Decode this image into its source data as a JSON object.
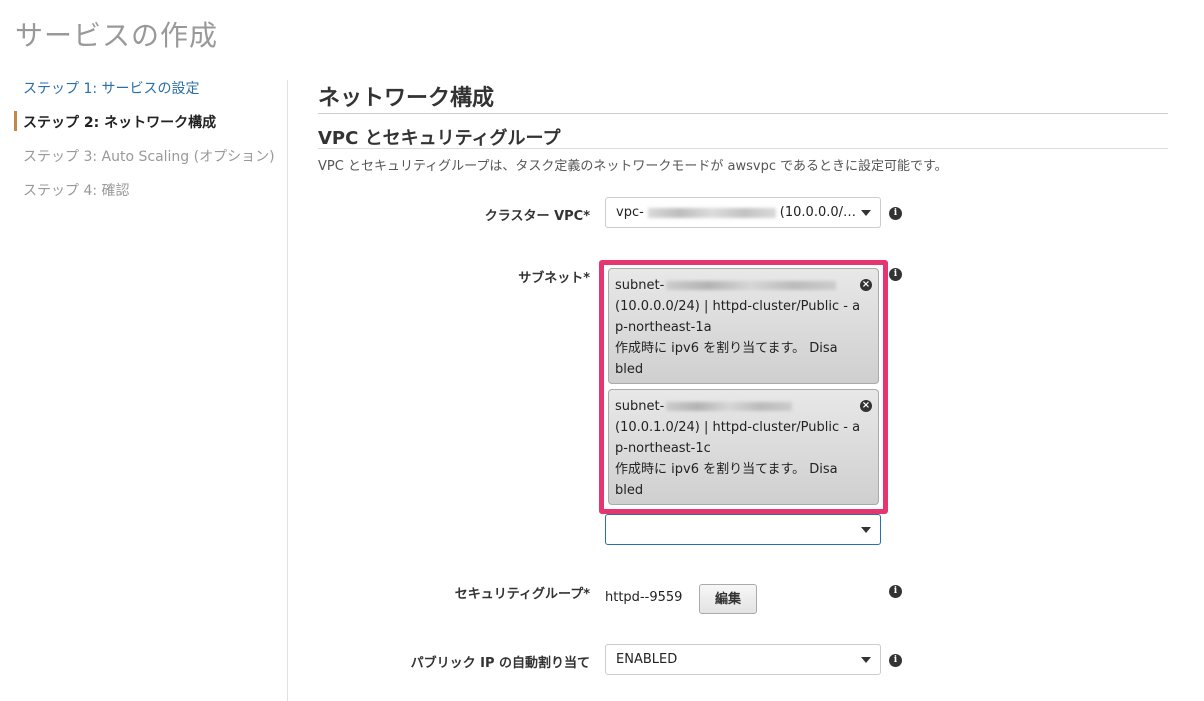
{
  "page": {
    "title": "サービスの作成"
  },
  "sidebar": {
    "steps": [
      {
        "label": "ステップ 1: サービスの設定",
        "state": "link"
      },
      {
        "label": "ステップ 2: ネットワーク構成",
        "state": "active"
      },
      {
        "label": "ステップ 3: Auto Scaling (オプション)",
        "state": "disabled"
      },
      {
        "label": "ステップ 4: 確認",
        "state": "disabled"
      }
    ]
  },
  "main": {
    "section_title": "ネットワーク構成",
    "subsection_title": "VPC とセキュリティグループ",
    "description": "VPC とセキュリティグループは、タスク定義のネットワークモードが awsvpc であるときに設定可能です。"
  },
  "form": {
    "cluster_vpc": {
      "label": "クラスター VPC*",
      "value_prefix": "vpc-",
      "value_suffix": "(10.0.0.0/…",
      "icon": "chevron-down-icon"
    },
    "subnets": {
      "label": "サブネット*",
      "selected": [
        {
          "line1": "subnet-",
          "line2": "(10.0.0.0/24) | httpd-cluster/Public - a",
          "line3": "p-northeast-1a",
          "line4": "作成時に ipv6 を割り当てます。 Disa",
          "line5": "bled"
        },
        {
          "line1": "subnet-",
          "line2": "(10.0.1.0/24) | httpd-cluster/Public - a",
          "line3": "p-northeast-1c",
          "line4": "作成時に ipv6 を割り当てます。 Disa",
          "line5": "bled"
        }
      ],
      "input_value": ""
    },
    "security_group": {
      "label": "セキュリティグループ*",
      "value": "httpd--9559",
      "edit_label": "編集"
    },
    "public_ip": {
      "label": "パブリック IP の自動割り当て",
      "value": "ENABLED"
    }
  },
  "colors": {
    "highlight_border": "#e6356f",
    "active_step_bar": "#c4874a",
    "link": "#2a6fa8"
  }
}
